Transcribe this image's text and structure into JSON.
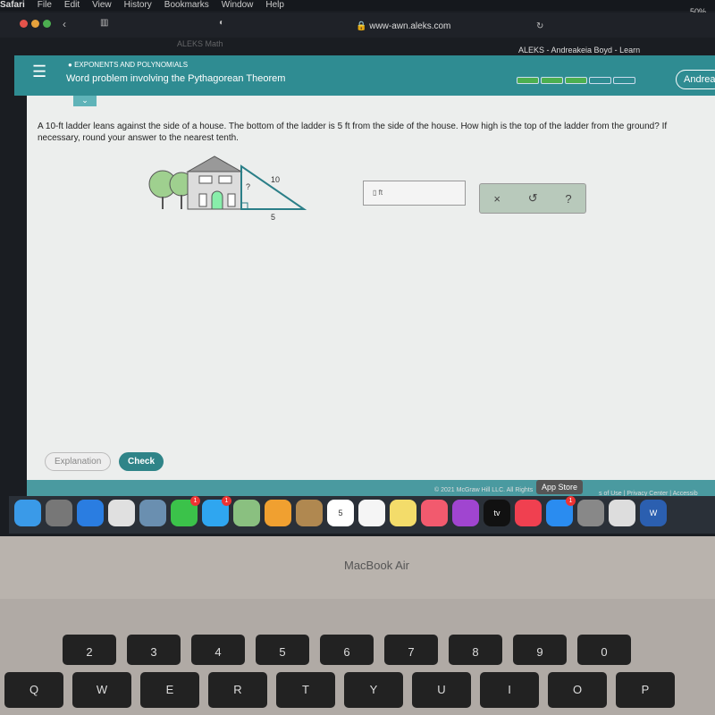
{
  "menubar": {
    "items": [
      "Safari",
      "File",
      "Edit",
      "View",
      "History",
      "Bookmarks",
      "Window",
      "Help"
    ],
    "battery": "50%"
  },
  "browser": {
    "url": "www-awn.aleks.com",
    "tab_left": "ALEKS Math",
    "tab_right": "ALEKS - Andreakeia Boyd - Learn"
  },
  "header": {
    "category": "EXPONENTS AND POLYNOMIALS",
    "title": "Word problem involving the Pythagorean Theorem",
    "progress_filled": 3,
    "progress_total": 5,
    "user": "Andrea"
  },
  "question": {
    "text": "A 10-ft ladder leans against the side of a house. The bottom of the ladder is 5 ft from the side of the house. How high is the top of the ladder from the ground? If necessary, round your answer to the nearest tenth.",
    "figure": {
      "hypotenuse": "10",
      "base": "5",
      "unknown": "?"
    },
    "answer_value": "",
    "answer_unit": "ft"
  },
  "tools": {
    "clear": "×",
    "undo": "↺",
    "help": "?"
  },
  "buttons": {
    "explanation": "Explanation",
    "check": "Check"
  },
  "footer": {
    "copyright": "© 2021 McGraw Hill LLC. All Rights",
    "links": "s of Use  |  Privacy Center  |  Accessib"
  },
  "tooltip": "App Store",
  "dock": [
    {
      "name": "finder",
      "color": "#3a9ae8"
    },
    {
      "name": "launchpad",
      "color": "#777"
    },
    {
      "name": "safari",
      "color": "#2a7de1"
    },
    {
      "name": "chrome",
      "color": "#e0e0e0"
    },
    {
      "name": "preview",
      "color": "#6a8fb0"
    },
    {
      "name": "facetime",
      "color": "#3bc24a",
      "badge": "1"
    },
    {
      "name": "messages",
      "color": "#2fa6f0",
      "badge": "1"
    },
    {
      "name": "maps",
      "color": "#8ac080"
    },
    {
      "name": "photos",
      "color": "#f0a030"
    },
    {
      "name": "contacts",
      "color": "#b08850"
    },
    {
      "name": "calendar",
      "color": "#fff",
      "label": "5"
    },
    {
      "name": "reminders",
      "color": "#f5f5f5"
    },
    {
      "name": "notes",
      "color": "#f3dc6a"
    },
    {
      "name": "music",
      "color": "#f25a6e"
    },
    {
      "name": "podcasts",
      "color": "#a045d0"
    },
    {
      "name": "tv",
      "color": "#111",
      "label": "tv"
    },
    {
      "name": "news",
      "color": "#f04050"
    },
    {
      "name": "app-store",
      "color": "#2a8cf0",
      "badge": "1"
    },
    {
      "name": "system-preferences",
      "color": "#888"
    },
    {
      "name": "documents",
      "color": "#ddd"
    },
    {
      "name": "word",
      "color": "#2b5fb0",
      "label": "W"
    }
  ],
  "laptop": {
    "brand": "MacBook Air"
  },
  "keys": {
    "numbers": [
      "2",
      "3",
      "4",
      "5",
      "6",
      "7",
      "8",
      "9",
      "0"
    ],
    "letters": [
      "Q",
      "W",
      "E",
      "R",
      "T",
      "Y",
      "U",
      "I",
      "O",
      "P"
    ]
  }
}
